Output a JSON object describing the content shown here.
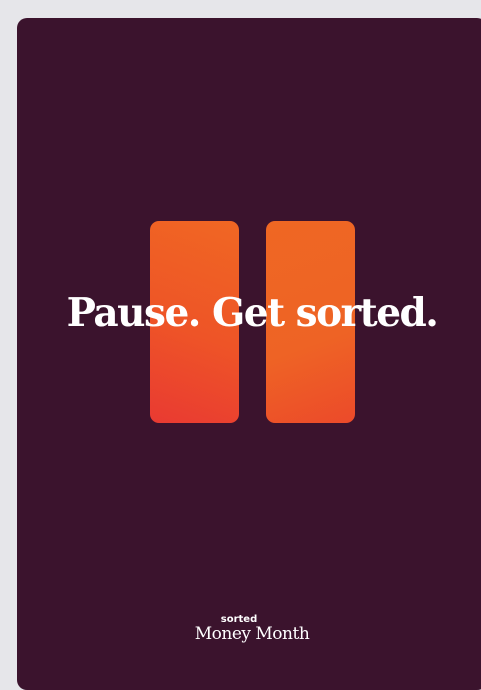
{
  "poster": {
    "headline": "Pause. Get sorted.",
    "brand": {
      "small": "sorted",
      "large": "Money Month"
    }
  },
  "colors": {
    "background": "#3b132d",
    "accent_orange": "#f06723",
    "accent_red": "#e93a32",
    "text": "#ffffff"
  },
  "icons": [
    "pause-icon"
  ]
}
